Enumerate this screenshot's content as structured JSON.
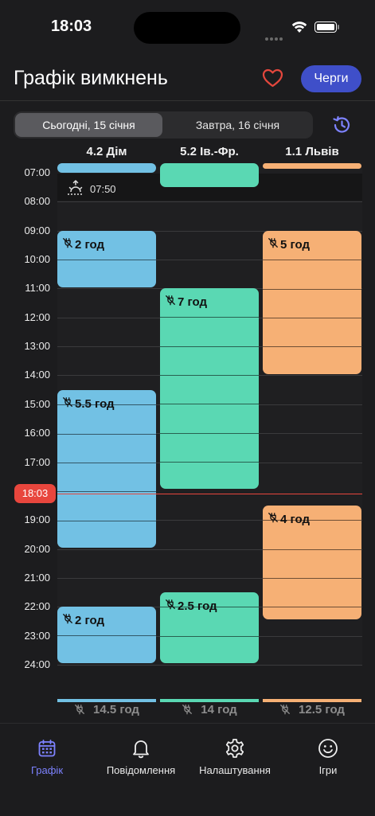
{
  "status_bar": {
    "time": "18:03"
  },
  "header": {
    "title": "Графік вимкнень",
    "queues_button": "Черги",
    "favorite_icon": "heart-icon"
  },
  "segment": {
    "today": "Сьогодні, 15 січня",
    "tomorrow": "Завтра, 16 січня",
    "selected": "today"
  },
  "columns": [
    {
      "name": "4.2 Дім",
      "color": "#72c1e4",
      "total": "14.5 год"
    },
    {
      "name": "5.2 Ів.-Фр.",
      "color": "#5ad8b3",
      "total": "14 год"
    },
    {
      "name": "1.1 Львів",
      "color": "#f6b075",
      "total": "12.5 год"
    }
  ],
  "hours": [
    "07:00",
    "08:00",
    "09:00",
    "10:00",
    "11:00",
    "12:00",
    "13:00",
    "14:00",
    "15:00",
    "16:00",
    "17:00",
    "18:03",
    "19:00",
    "20:00",
    "21:00",
    "22:00",
    "23:00",
    "24:00"
  ],
  "sunrise": {
    "time": "07:50"
  },
  "outages": [
    {
      "column": 0,
      "start": 9.0,
      "end": 11.0,
      "label": "2 год"
    },
    {
      "column": 0,
      "start": 14.5,
      "end": 20.0,
      "label": "5.5 год"
    },
    {
      "column": 0,
      "start": 22.0,
      "end": 24.0,
      "label": "2 год"
    },
    {
      "column": 1,
      "start": 11.0,
      "end": 18.0,
      "label": "7 год"
    },
    {
      "column": 1,
      "start": 21.5,
      "end": 24.0,
      "label": "2.5 год"
    },
    {
      "column": 2,
      "start": 9.0,
      "end": 14.0,
      "label": "5 год"
    },
    {
      "column": 2,
      "start": 18.5,
      "end": 22.5,
      "label": "4 год"
    }
  ],
  "now": "18:03",
  "tabs": [
    {
      "label": "Графік",
      "icon": "calendar-icon",
      "active": true
    },
    {
      "label": "Повідомлення",
      "icon": "bell-icon",
      "active": false
    },
    {
      "label": "Налаштування",
      "icon": "gear-icon",
      "active": false
    },
    {
      "label": "Ігри",
      "icon": "smiley-icon",
      "active": false
    }
  ]
}
